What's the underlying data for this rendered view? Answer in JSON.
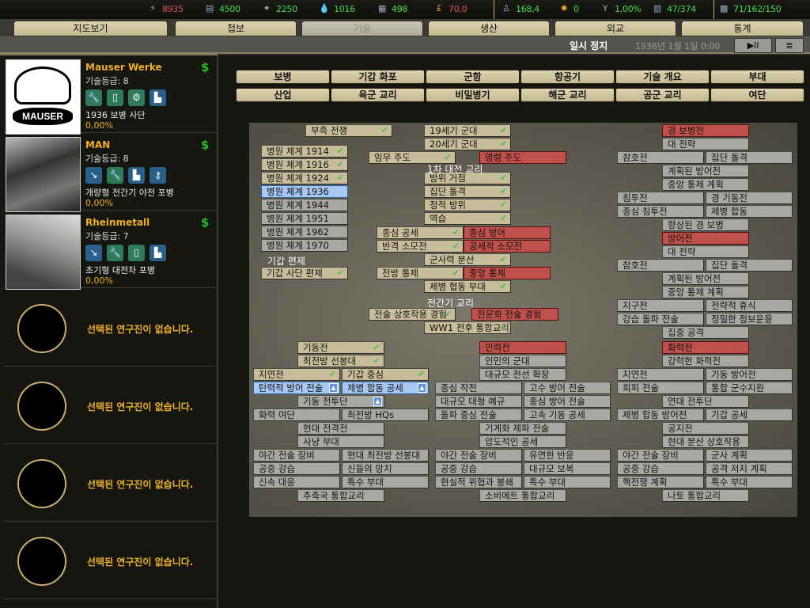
{
  "resources": [
    {
      "icon": "energy-icon",
      "value": "8935",
      "color": "red"
    },
    {
      "icon": "metal-icon",
      "value": "4500",
      "color": "green"
    },
    {
      "icon": "rare-materials-icon",
      "value": "2250",
      "color": "green"
    },
    {
      "icon": "oil-icon",
      "value": "1016",
      "color": "green"
    },
    {
      "icon": "supplies-icon",
      "value": "498",
      "color": "green"
    },
    {
      "icon": "money-icon",
      "value": "70,0",
      "color": "red"
    },
    {
      "icon": "manpower-icon",
      "value": "168,4",
      "color": "green"
    },
    {
      "icon": "nuke-icon",
      "value": "0",
      "color": "green"
    },
    {
      "icon": "dissent-icon",
      "value": "1,00%",
      "color": "green"
    },
    {
      "icon": "transport-icon",
      "value": "47/374",
      "color": "green"
    },
    {
      "icon": "convoy-icon",
      "value": "71/162/150",
      "color": "green"
    }
  ],
  "tabs": [
    "지도보기",
    "첩보",
    "기술",
    "생산",
    "외교",
    "통계"
  ],
  "active_tab": "기술",
  "status": {
    "pause": "일시 정지",
    "date": "1936년 1월 1일 0:00",
    "play": "▶ll",
    "menu": "≣"
  },
  "firms": [
    {
      "name": "Mauser Werke",
      "level": "기술등급: 8",
      "project": "1936 보병 사단",
      "progress": "0,00%",
      "logo_text": "MAUSER",
      "icons": [
        "wrench-icon",
        "book-icon",
        "gear-doc-icon",
        "chart-icon"
      ]
    },
    {
      "name": "MAN",
      "level": "기술등급: 8",
      "project": "개량형 전간기 야전 포병",
      "progress": "0,00%",
      "icons": [
        "artillery-icon",
        "wrench-icon",
        "chart-icon",
        "key-gear-icon"
      ]
    },
    {
      "name": "Rheinmetall",
      "level": "기술등급: 7",
      "project": "초기형 대전차 포병",
      "progress": "0,00%",
      "icons": [
        "artillery-icon",
        "wrench-icon",
        "book-icon",
        "chart-icon"
      ]
    }
  ],
  "empty_slot": "선택된 연구진이 없습니다.",
  "categories": [
    "보병",
    "기갑 화포",
    "군함",
    "항공기",
    "기술 개요",
    "부대",
    "산업",
    "육군 교리",
    "비밀병기",
    "해군 교리",
    "공군 교리",
    "여단"
  ],
  "colors": {
    "done": "#c8bd9a",
    "unavailable": "#c0504a",
    "selected": "#a8c8f4",
    "locked": "#a7a9a5"
  },
  "tree": {
    "headings": [
      "1차 대전 교리",
      "기갑 편제",
      "전간기 교리"
    ],
    "nodes": [
      {
        "label": "부족 전쟁",
        "status": "d"
      },
      {
        "label": "19세기 군대",
        "status": "d"
      },
      {
        "label": "20세기 군대",
        "status": "d"
      },
      {
        "label": "병원 체계 1914",
        "status": "d"
      },
      {
        "label": "병원 체계 1916",
        "status": "d"
      },
      {
        "label": "병원 체계 1924",
        "status": "d"
      },
      {
        "label": "병원 체계 1936",
        "status": "s"
      },
      {
        "label": "병원 체계 1944",
        "status": "g"
      },
      {
        "label": "병원 체계 1951",
        "status": "g"
      },
      {
        "label": "병원 체계 1962",
        "status": "g"
      },
      {
        "label": "병원 체계 1970",
        "status": "g"
      },
      {
        "label": "임무 주도",
        "status": "d"
      },
      {
        "label": "명령 주도",
        "status": "r"
      },
      {
        "label": "방위 거점",
        "status": "d"
      },
      {
        "label": "집단 돌격",
        "status": "d"
      },
      {
        "label": "정적 방위",
        "status": "d"
      },
      {
        "label": "역습",
        "status": "d"
      },
      {
        "label": "종심 공세",
        "status": "d"
      },
      {
        "label": "종심 방어",
        "status": "r"
      },
      {
        "label": "반격 소모전",
        "status": "d"
      },
      {
        "label": "공세적 소모전",
        "status": "r"
      },
      {
        "label": "군사력 분산",
        "status": "d"
      },
      {
        "label": "기갑 사단 편제",
        "status": "d"
      },
      {
        "label": "전방 통제",
        "status": "d"
      },
      {
        "label": "중앙 통제",
        "status": "r"
      },
      {
        "label": "제병 협동 부대",
        "status": "d"
      },
      {
        "label": "전술 상호작용 경험",
        "status": "d"
      },
      {
        "label": "전문화 전술 경험",
        "status": "r"
      },
      {
        "label": "WW1 전후 통합교리",
        "status": "d"
      },
      {
        "label": "경 보병전",
        "status": "r"
      },
      {
        "label": "대 전략",
        "status": "g"
      },
      {
        "label": "참호전",
        "status": "g"
      },
      {
        "label": "집단 돌격",
        "status": "g"
      },
      {
        "label": "계획된 방어전",
        "status": "g"
      },
      {
        "label": "중앙 통제 계획",
        "status": "g"
      },
      {
        "label": "침투전",
        "status": "g"
      },
      {
        "label": "경 기동전",
        "status": "g"
      },
      {
        "label": "종심 침투전",
        "status": "g"
      },
      {
        "label": "제병 합동",
        "status": "g"
      },
      {
        "label": "향상된 경 보병",
        "status": "g"
      },
      {
        "label": "방어전",
        "status": "r"
      },
      {
        "label": "대 전략",
        "status": "g"
      },
      {
        "label": "참호전",
        "status": "g"
      },
      {
        "label": "집단 돌격",
        "status": "g"
      },
      {
        "label": "계획된 방어전",
        "status": "g"
      },
      {
        "label": "중앙 통제 계획",
        "status": "g"
      },
      {
        "label": "지구전",
        "status": "g"
      },
      {
        "label": "전략적 휴식",
        "status": "g"
      },
      {
        "label": "강습 돌파 전술",
        "status": "g"
      },
      {
        "label": "정밀한 정보운용",
        "status": "g"
      },
      {
        "label": "집중 공격",
        "status": "g"
      },
      {
        "label": "기동전",
        "status": "d"
      },
      {
        "label": "최전방 선봉대",
        "status": "d"
      },
      {
        "label": "지연전",
        "status": "d"
      },
      {
        "label": "기갑 중심",
        "status": "d"
      },
      {
        "label": "탄력적 방어 전술",
        "status": "s",
        "blueprint": true
      },
      {
        "label": "제병 합동 공세",
        "status": "s",
        "blueprint": true
      },
      {
        "label": "기동 전투단",
        "status": "g",
        "blueprint": true
      },
      {
        "label": "화력 여단",
        "status": "g"
      },
      {
        "label": "최전방 HQs",
        "status": "g"
      },
      {
        "label": "현대 전격전",
        "status": "g"
      },
      {
        "label": "사냥 부대",
        "status": "g"
      },
      {
        "label": "야간 전술 장비",
        "status": "g"
      },
      {
        "label": "현대 최전방 선봉대",
        "status": "g"
      },
      {
        "label": "공중 강습",
        "status": "g"
      },
      {
        "label": "신들의 망치",
        "status": "g"
      },
      {
        "label": "신속 대응",
        "status": "g"
      },
      {
        "label": "특수 부대",
        "status": "g"
      },
      {
        "label": "추축국 통합교리",
        "status": "g"
      },
      {
        "label": "인력전",
        "status": "r"
      },
      {
        "label": "인민의 군대",
        "status": "g"
      },
      {
        "label": "대규모 전선 확장",
        "status": "g"
      },
      {
        "label": "종심 작전",
        "status": "g"
      },
      {
        "label": "고수 방어 전술",
        "status": "g"
      },
      {
        "label": "대규모 대형 예규",
        "status": "g"
      },
      {
        "label": "종심 방어 전술",
        "status": "g"
      },
      {
        "label": "돌파 중심 전술",
        "status": "g"
      },
      {
        "label": "고속 기동 공세",
        "status": "g"
      },
      {
        "label": "기계화 제파 전술",
        "status": "g"
      },
      {
        "label": "압도적인 공세",
        "status": "g"
      },
      {
        "label": "야간 전술 장비",
        "status": "g"
      },
      {
        "label": "유연한 반응",
        "status": "g"
      },
      {
        "label": "공중 강습",
        "status": "g"
      },
      {
        "label": "대규모 보복",
        "status": "g"
      },
      {
        "label": "현실적 위협과 봉쇄",
        "status": "g"
      },
      {
        "label": "특수 부대",
        "status": "g"
      },
      {
        "label": "소비에트 통합교리",
        "status": "g"
      },
      {
        "label": "화력전",
        "status": "r"
      },
      {
        "label": "강력한 화력전",
        "status": "g"
      },
      {
        "label": "지연전",
        "status": "g"
      },
      {
        "label": "기동 방어전",
        "status": "g"
      },
      {
        "label": "회피 전술",
        "status": "g"
      },
      {
        "label": "통합 군수지원",
        "status": "g"
      },
      {
        "label": "연대 전투단",
        "status": "g"
      },
      {
        "label": "제병 합동 방어전",
        "status": "g"
      },
      {
        "label": "기갑 공세",
        "status": "g"
      },
      {
        "label": "공지전",
        "status": "g"
      },
      {
        "label": "현대 분산 상호작용",
        "status": "g"
      },
      {
        "label": "야간 전술 장비",
        "status": "g"
      },
      {
        "label": "군사 계획",
        "status": "g"
      },
      {
        "label": "공중 강습",
        "status": "g"
      },
      {
        "label": "공격 저지 계획",
        "status": "g"
      },
      {
        "label": "핵전쟁 계획",
        "status": "g"
      },
      {
        "label": "특수 부대",
        "status": "g"
      },
      {
        "label": "나토 통합교리",
        "status": "g"
      }
    ]
  }
}
